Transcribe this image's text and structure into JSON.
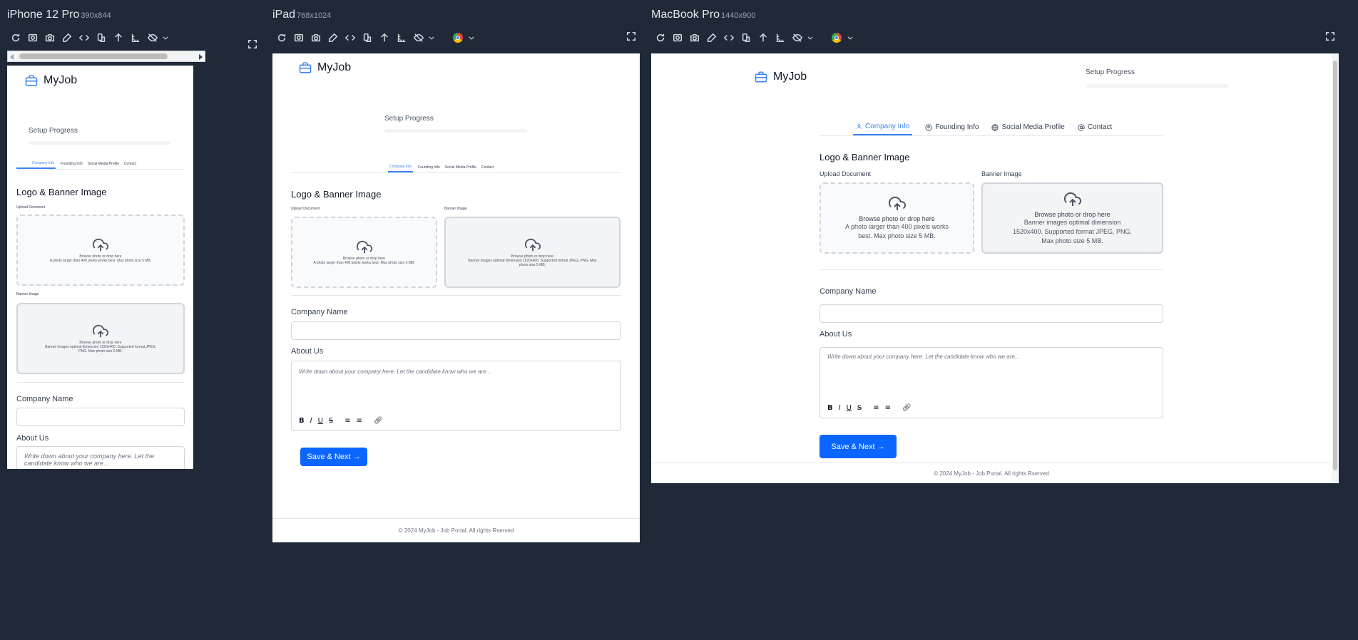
{
  "devices": [
    {
      "name": "iPhone 12 Pro",
      "dims": "390x844"
    },
    {
      "name": "iPad",
      "dims": "768x1024"
    },
    {
      "name": "MacBook Pro",
      "dims": "1440x900"
    }
  ],
  "app": {
    "brand": "MyJob",
    "setup_progress": "Setup Progress",
    "tabs": [
      "Company Info",
      "Founding Info",
      "Social Media Profile",
      "Contact"
    ],
    "section_title": "Logo & Banner Image",
    "upload_label": "Upload Document",
    "banner_label": "Banner Image",
    "browse_text": "Browse photo or drop here",
    "upload_hint": "A photo larger than 400 pixels works best. Max photo size 5 MB.",
    "banner_hint": "Banner images optimal dimension 1520x400. Supported format JPEG, PNG. Max photo size 5 MB.",
    "company_name_label": "Company Name",
    "about_label": "About Us",
    "about_placeholder": "Write down about your company here. Let the candidate know who we are...",
    "save_button": "Save & Next →",
    "footer": "© 2024 MyJob - Job Portal. All rights Rserved"
  },
  "colors": {
    "accent": "#0a66ff",
    "brand_icon": "#3b82f6",
    "background": "#1f2937"
  },
  "icons": [
    "reload-icon",
    "screenshot-icon",
    "camera-icon",
    "eyedropper-icon",
    "code-icon",
    "rotate-icon",
    "arrow-up-icon",
    "ruler-icon",
    "eye-off-icon",
    "chevron-down-icon",
    "chrome-icon",
    "expand-icon",
    "briefcase-icon",
    "upload-cloud-icon"
  ]
}
